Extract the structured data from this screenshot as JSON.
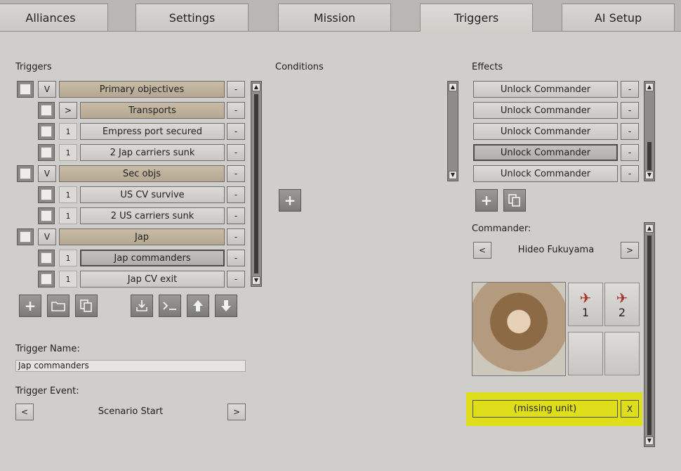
{
  "tabs": [
    "Alliances",
    "Settings",
    "Mission",
    "Triggers",
    "AI Setup"
  ],
  "active_tab": "Triggers",
  "sections": {
    "triggers": "Triggers",
    "conditions": "Conditions",
    "effects": "Effects",
    "commander": "Commander:"
  },
  "triggers": [
    {
      "toggle": "V",
      "label": "Primary objectives",
      "type": "group",
      "remove": "-"
    },
    {
      "toggle": ">",
      "label": "Transports",
      "type": "group",
      "remove": "-"
    },
    {
      "toggle": "1",
      "label": "Empress port secured",
      "type": "item",
      "remove": "-"
    },
    {
      "toggle": "1",
      "label": "2 Jap carriers sunk",
      "type": "item",
      "remove": "-"
    },
    {
      "toggle": "V",
      "label": "Sec objs",
      "type": "group",
      "remove": "-"
    },
    {
      "toggle": "1",
      "label": "US CV survive",
      "type": "item",
      "remove": "-"
    },
    {
      "toggle": "1",
      "label": "2 US carriers sunk",
      "type": "item",
      "remove": "-"
    },
    {
      "toggle": "V",
      "label": "Jap",
      "type": "group",
      "remove": "-"
    },
    {
      "toggle": "1",
      "label": "Jap commanders",
      "type": "selected",
      "remove": "-"
    },
    {
      "toggle": "1",
      "label": "Jap CV exit",
      "type": "item",
      "remove": "-"
    }
  ],
  "effects": [
    {
      "label": "Unlock Commander",
      "remove": "-"
    },
    {
      "label": "Unlock Commander",
      "remove": "-"
    },
    {
      "label": "Unlock Commander",
      "remove": "-"
    },
    {
      "label": "Unlock Commander",
      "remove": "-"
    },
    {
      "label": "Unlock Commander",
      "remove": "-"
    }
  ],
  "trigger_name": {
    "label": "Trigger Name:",
    "value": "Jap commanders"
  },
  "trigger_event": {
    "label": "Trigger Event:",
    "value": "Scenario Start",
    "prev": "<",
    "next": ">"
  },
  "commander": {
    "name": "Hideo Fukuyama",
    "prev": "<",
    "next": ">"
  },
  "units": [
    {
      "icon": "plane-icon",
      "count": "1"
    },
    {
      "icon": "plane-icon",
      "count": "2"
    }
  ],
  "missing_unit": {
    "label": "(missing unit)",
    "remove": "X"
  },
  "icons": {
    "add": "+",
    "scroll_up": "▲",
    "scroll_down": "▼"
  },
  "colors": {
    "group_bar": "#b4a892",
    "highlight": "#dede1a",
    "plane": "#a8352c"
  }
}
